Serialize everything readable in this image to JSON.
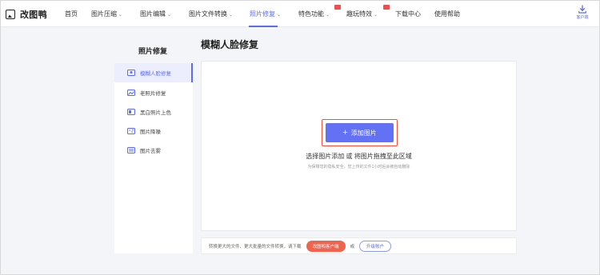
{
  "brand": {
    "name": "改图鸭"
  },
  "nav": {
    "items": [
      {
        "label": "首页"
      },
      {
        "label": "图片压缩"
      },
      {
        "label": "图片编辑"
      },
      {
        "label": "图片文件转换"
      },
      {
        "label": "照片修复"
      },
      {
        "label": "特色功能"
      },
      {
        "label": "趣玩特效"
      },
      {
        "label": "下载中心"
      },
      {
        "label": "使用帮助"
      }
    ],
    "active_index": 4,
    "client_label": "客户端"
  },
  "sidebar": {
    "title": "照片修复",
    "items": [
      {
        "label": "模糊人脸修复",
        "icon": "face-restore-icon",
        "active": true
      },
      {
        "label": "老照片修复",
        "icon": "old-photo-icon",
        "active": false
      },
      {
        "label": "黑白照片上色",
        "icon": "colorize-icon",
        "active": false
      },
      {
        "label": "图片降噪",
        "icon": "denoise-icon",
        "active": false
      },
      {
        "label": "图片去雾",
        "icon": "dehaze-icon",
        "active": false
      }
    ]
  },
  "main": {
    "title": "模糊人脸修复",
    "add_button": "添加图片",
    "hint": "选择图片添加 或 将图片拖拽至此区域",
    "privacy_note": "为保障您的隐私安全，您上传的文件1小时后会被自动删除"
  },
  "bottom_bar": {
    "text": "转换更大的文件、更大批量的文件转换，请下载",
    "client_button": "改图鸭客户端",
    "or": "或",
    "upgrade_button": "升级账户"
  },
  "colors": {
    "accent": "#5b6cf3",
    "button": "#6372f5",
    "highlight": "#f0523e"
  }
}
